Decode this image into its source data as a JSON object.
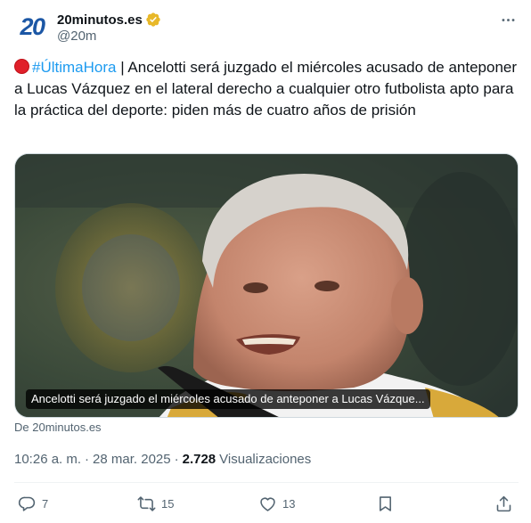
{
  "account": {
    "avatar_text": "20",
    "display_name": "20minutos.es",
    "handle": "@20m",
    "verified_color": "#e8b829"
  },
  "tweet": {
    "hashtag": "#ÚltimaHora",
    "text": " | Ancelotti será juzgado el miércoles acusado de anteponer a Lucas Vázquez en el lateral derecho a cualquier otro futbolista apto para la práctica del deporte: piden más de cuatro años de prisión",
    "link_color": "#1d9bf0"
  },
  "media": {
    "caption": "Ancelotti será juzgado el miércoles acusado de anteponer a Lucas Vázque...",
    "source": "De 20minutos.es"
  },
  "meta": {
    "time": "10:26 a. m.",
    "separator": "·",
    "date": "28 mar. 2025",
    "views_count": "2.728",
    "views_label": "Visualizaciones"
  },
  "actions": {
    "replies": "7",
    "reposts": "15",
    "likes": "13"
  },
  "icons": [
    "verified-badge-icon",
    "more-icon",
    "reply-icon",
    "repost-icon",
    "like-icon",
    "bookmark-icon",
    "share-icon"
  ]
}
